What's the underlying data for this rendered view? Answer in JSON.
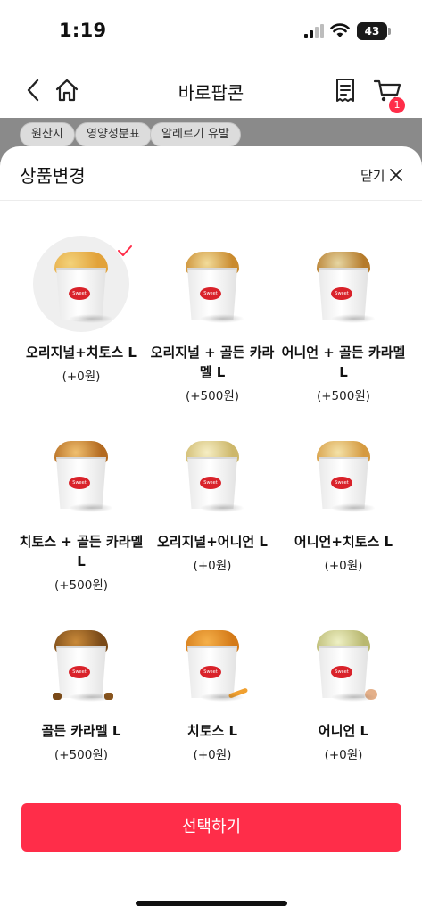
{
  "status": {
    "time": "1:19",
    "battery": "43"
  },
  "header": {
    "title": "바로팝콘",
    "cart_count": "1"
  },
  "chips": [
    "원산지",
    "영양성분표",
    "알레르기 유발"
  ],
  "sheet": {
    "title": "상품변경",
    "close_label": "닫기",
    "items": [
      {
        "name": "오리지널+치토스 L",
        "price": "(+0원)",
        "selected": true
      },
      {
        "name": "오리지널 + 골든 카라멜 L",
        "price": "(+500원)",
        "selected": false
      },
      {
        "name": "어니언 + 골든 카라멜 L",
        "price": "(+500원)",
        "selected": false
      },
      {
        "name": "치토스 + 골든 카라멜 L",
        "price": "(+500원)",
        "selected": false
      },
      {
        "name": "오리지널+어니언 L",
        "price": "(+0원)",
        "selected": false
      },
      {
        "name": "어니언+치토스 L",
        "price": "(+0원)",
        "selected": false
      },
      {
        "name": "골든 카라멜 L",
        "price": "(+500원)",
        "selected": false
      },
      {
        "name": "치토스 L",
        "price": "(+0원)",
        "selected": false
      },
      {
        "name": "어니언 L",
        "price": "(+0원)",
        "selected": false
      }
    ],
    "cta_label": "선택하기"
  },
  "colors": {
    "accent": "#ff2d49",
    "overlay": "#8a8a8a"
  },
  "icons": [
    "back-icon",
    "home-icon",
    "receipt-icon",
    "cart-icon",
    "check-icon",
    "close-icon"
  ]
}
